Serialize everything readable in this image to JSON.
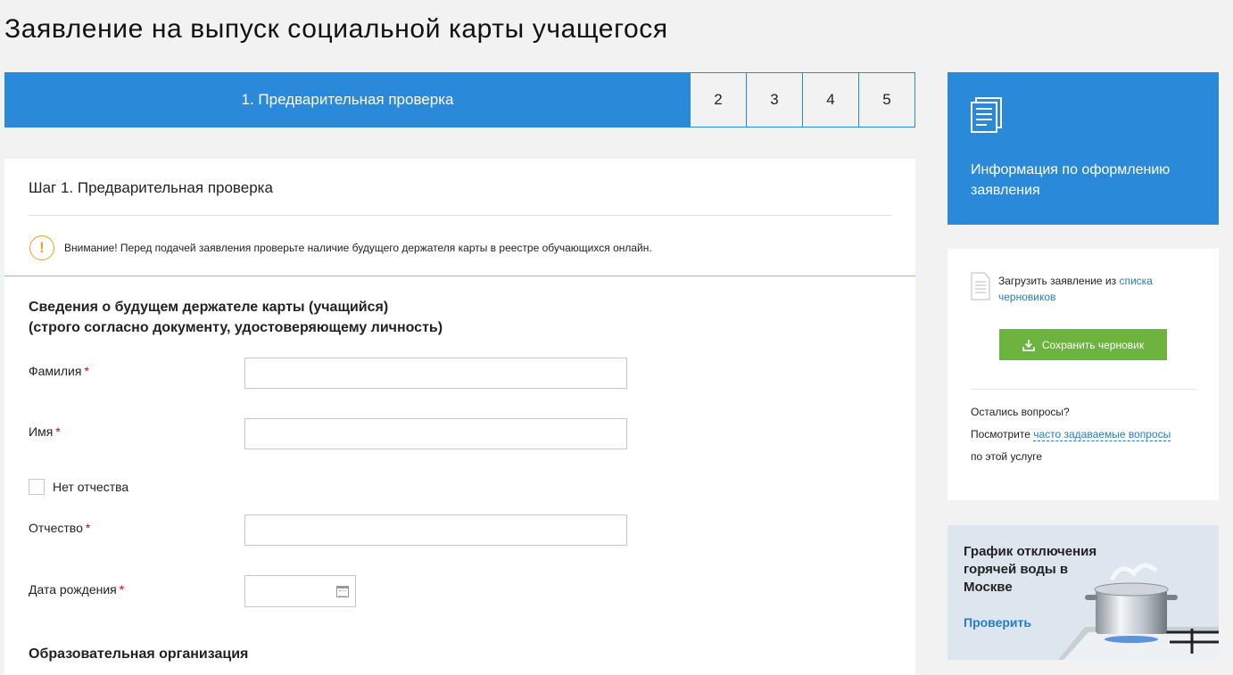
{
  "page": {
    "title": "Заявление на выпуск социальной карты учащегося"
  },
  "stepper": {
    "active": "1. Предварительная проверка",
    "steps": [
      "2",
      "3",
      "4",
      "5"
    ]
  },
  "form": {
    "step_title": "Шаг 1. Предварительная проверка",
    "warning": "Внимание! Перед подачей заявления проверьте наличие будущего держателя карты в реестре обучающихся онлайн.",
    "warning_icon": "!",
    "section_title_line1": "Сведения о будущем держателе карты (учащийся)",
    "section_title_line2": "(строго согласно документу, удостоверяющему личность)",
    "required_mark": "*",
    "fields": {
      "lastname": {
        "label": "Фамилия",
        "value": ""
      },
      "firstname": {
        "label": "Имя",
        "value": ""
      },
      "no_patronymic": {
        "label": "Нет отчества",
        "checked": false
      },
      "patronymic": {
        "label": "Отчество",
        "value": ""
      },
      "birthdate": {
        "label": "Дата рождения",
        "value": ""
      }
    },
    "org_title": "Образовательная организация"
  },
  "sidebar": {
    "info": {
      "text": "Информация по оформлению заявления",
      "icon": "document-icon"
    },
    "drafts": {
      "text_prefix": "Загрузить заявление из ",
      "link": "списка черновиков",
      "save_button": "Сохранить черновик",
      "questions": "Остались вопросы?",
      "faq_prefix": "Посмотрите ",
      "faq_link": "часто задаваемые вопросы",
      "faq_suffix": "по этой услуге"
    },
    "promo": {
      "title": "График отключения горячей воды в Москве",
      "link": "Проверить"
    }
  },
  "colors": {
    "primary": "#2a8ad9",
    "success": "#6cb33f",
    "warning": "#f0a020",
    "link": "#2a7ac8"
  }
}
